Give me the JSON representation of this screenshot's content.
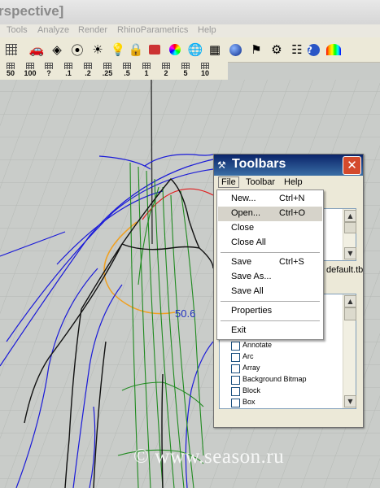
{
  "window": {
    "title": "rspective]"
  },
  "menubar": {
    "items": [
      "Tools",
      "Analyze",
      "Render",
      "RhinoParametrics",
      "Help"
    ]
  },
  "snap_toolbar": {
    "labels": [
      "50",
      "100",
      "?",
      ".1",
      ".2",
      ".25",
      ".5",
      "1",
      "2",
      "5",
      "10"
    ]
  },
  "viewport": {
    "dimension_label": "50.6"
  },
  "dialog": {
    "title": "Toolbars",
    "close_label": "✕",
    "menu": [
      "File",
      "Toolbar",
      "Help"
    ],
    "file_label": "default.tb",
    "toolbars": [
      "Annotate",
      "Arc",
      "Array",
      "Background Bitmap",
      "Block",
      "Box"
    ]
  },
  "file_menu": {
    "items": [
      {
        "label": "New...",
        "shortcut": "Ctrl+N"
      },
      {
        "label": "Open...",
        "shortcut": "Ctrl+O"
      },
      {
        "label": "Close",
        "shortcut": ""
      },
      {
        "label": "Close All",
        "shortcut": ""
      },
      {
        "label": "Save",
        "shortcut": "Ctrl+S"
      },
      {
        "label": "Save As...",
        "shortcut": ""
      },
      {
        "label": "Save All",
        "shortcut": ""
      },
      {
        "label": "Properties",
        "shortcut": ""
      },
      {
        "label": "Exit",
        "shortcut": ""
      }
    ],
    "highlighted": "Open..."
  },
  "watermark": "© www.season.ru",
  "colors": {
    "titlebar_blue": "#0a246a",
    "close_red": "#d44a2c",
    "curve_blue": "#1a1ad8",
    "curve_green": "#1f8a1f",
    "curve_black": "#111111",
    "curve_red": "#e02020",
    "curve_orange": "#f0a020"
  }
}
